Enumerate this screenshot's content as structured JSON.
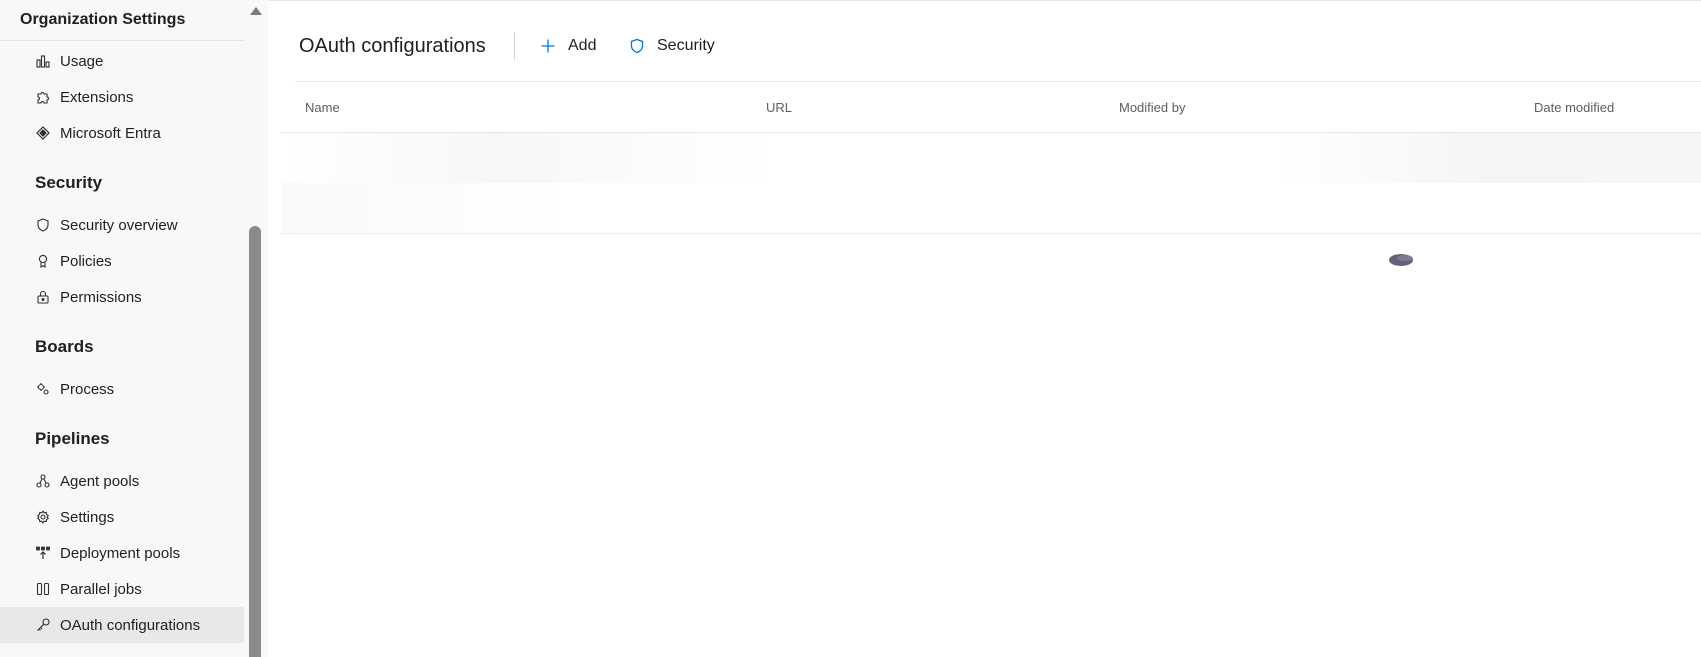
{
  "sidebar": {
    "header_title": "Organization Settings",
    "top_items": [
      {
        "label": "Usage",
        "icon": "usage-icon"
      },
      {
        "label": "Extensions",
        "icon": "extensions-icon"
      },
      {
        "label": "Microsoft Entra",
        "icon": "entra-icon"
      }
    ],
    "sections": [
      {
        "title": "Security",
        "items": [
          {
            "label": "Security overview",
            "icon": "shield-icon"
          },
          {
            "label": "Policies",
            "icon": "policy-icon"
          },
          {
            "label": "Permissions",
            "icon": "lock-icon"
          }
        ]
      },
      {
        "title": "Boards",
        "items": [
          {
            "label": "Process",
            "icon": "process-icon"
          }
        ]
      },
      {
        "title": "Pipelines",
        "items": [
          {
            "label": "Agent pools",
            "icon": "agent-pools-icon"
          },
          {
            "label": "Settings",
            "icon": "gear-icon"
          },
          {
            "label": "Deployment pools",
            "icon": "deployment-pools-icon"
          },
          {
            "label": "Parallel jobs",
            "icon": "parallel-jobs-icon"
          },
          {
            "label": "OAuth configurations",
            "icon": "key-icon",
            "selected": true
          }
        ]
      }
    ]
  },
  "main": {
    "title": "OAuth configurations",
    "commands": [
      {
        "label": "Add",
        "icon": "plus-icon"
      },
      {
        "label": "Security",
        "icon": "shield-icon"
      }
    ],
    "table": {
      "columns": [
        "Name",
        "URL",
        "Modified by",
        "Date modified"
      ],
      "loading": true
    }
  },
  "colors": {
    "accent": "#0078d4",
    "sidebar_bg": "#f8f8f8",
    "selected_bg": "#e8e8e8",
    "scroll_thumb": "#8a8a8a"
  }
}
